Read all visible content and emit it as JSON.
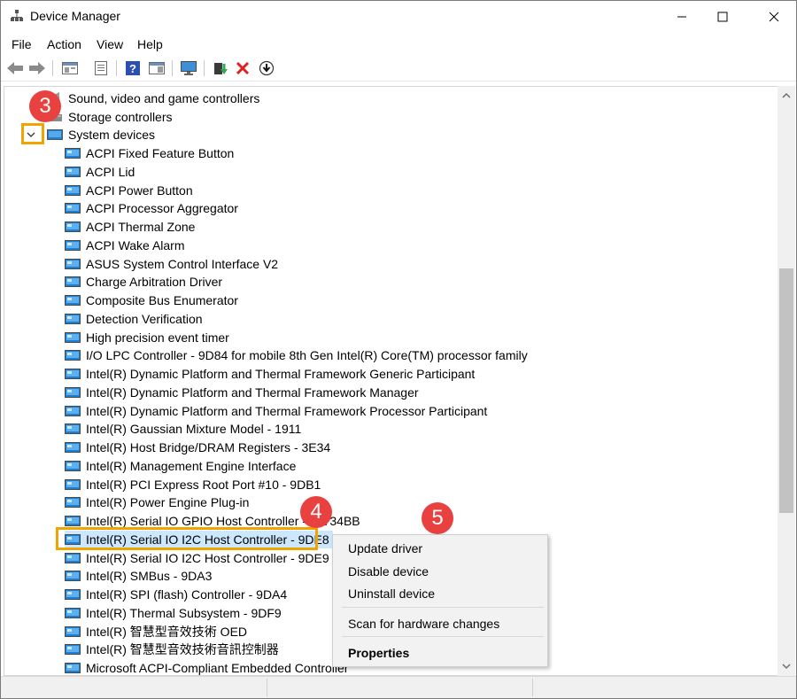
{
  "window": {
    "title": "Device Manager"
  },
  "menu": [
    "File",
    "Action",
    "View",
    "Help"
  ],
  "toolbar_icons": [
    "back-arrow-icon",
    "forward-arrow-icon",
    "console-tree-icon",
    "properties-sheet-icon",
    "help-icon",
    "action-pane-icon",
    "monitor-scan-icon",
    "update-driver-icon",
    "uninstall-device-icon",
    "download-icon"
  ],
  "tree": {
    "categories": [
      {
        "label": "Sound, video and game controllers"
      },
      {
        "label": "Storage controllers"
      },
      {
        "label": "System devices",
        "expanded": true
      }
    ],
    "devices": [
      "ACPI Fixed Feature Button",
      "ACPI Lid",
      "ACPI Power Button",
      "ACPI Processor Aggregator",
      "ACPI Thermal Zone",
      "ACPI Wake Alarm",
      "ASUS System Control Interface V2",
      "Charge Arbitration Driver",
      "Composite Bus Enumerator",
      "Detection Verification",
      "High precision event timer",
      "I/O LPC Controller - 9D84 for mobile 8th Gen Intel(R) Core(TM) processor family",
      "Intel(R) Dynamic Platform and Thermal Framework Generic Participant",
      "Intel(R) Dynamic Platform and Thermal Framework Manager",
      "Intel(R) Dynamic Platform and Thermal Framework Processor Participant",
      "Intel(R) Gaussian Mixture Model - 1911",
      "Intel(R) Host Bridge/DRAM Registers - 3E34",
      "Intel(R) Management Engine Interface",
      "Intel(R) PCI Express Root Port #10 - 9DB1",
      "Intel(R) Power Engine Plug-in",
      "Intel(R) Serial IO GPIO Host Controller - INT34BB",
      "Intel(R) Serial IO I2C Host Controller - 9DE8",
      "Intel(R) Serial IO I2C Host Controller - 9DE9",
      "Intel(R) SMBus - 9DA3",
      "Intel(R) SPI (flash) Controller - 9DA4",
      "Intel(R) Thermal Subsystem - 9DF9",
      "Intel(R) 智慧型音效技術 OED",
      "Intel(R) 智慧型音效技術音訊控制器",
      "Microsoft ACPI-Compliant Embedded Controller"
    ],
    "selected": "Intel(R) Serial IO I2C Host Controller - 9DE8"
  },
  "context_menu": {
    "items": [
      "Update driver",
      "Disable device",
      "Uninstall device",
      "Scan for hardware changes",
      "Properties"
    ]
  },
  "annotations": [
    "3",
    "4",
    "5"
  ],
  "colors": {
    "highlight": "#f0a400",
    "badge": "#e9413f",
    "selection": "#cce8ff"
  }
}
